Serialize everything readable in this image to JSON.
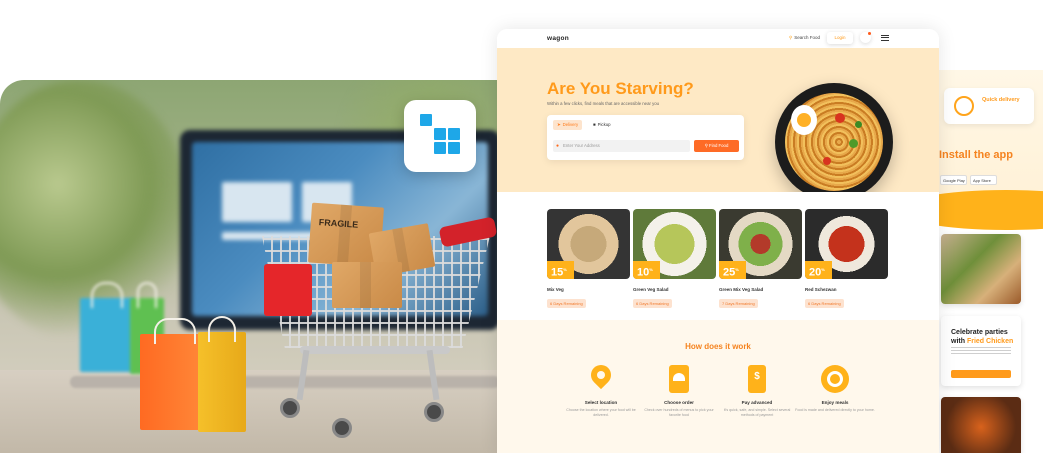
{
  "site": {
    "brand": "wagon",
    "nav": {
      "search": "Search Food",
      "login": "Login"
    },
    "hero": {
      "title": "Are You Starving?",
      "subtitle": "Within a few clicks, find meals that are accessible near you",
      "tabs": [
        {
          "label": "Delivery"
        },
        {
          "label": "Pickup"
        }
      ],
      "address_placeholder": "Enter Your Address",
      "find_button": "Find Food"
    },
    "foods": [
      {
        "discount": "15",
        "name": "Mix Veg",
        "remaining": "6 Days Remaining"
      },
      {
        "discount": "10",
        "name": "Green Veg Salad",
        "remaining": "6 Days Remaining"
      },
      {
        "discount": "25",
        "name": "Green Mix Veg Salad",
        "remaining": "7 Days Remaining"
      },
      {
        "discount": "20",
        "name": "Red Schezwan",
        "remaining": "6 Days Remaining"
      }
    ],
    "discount_suffix": "%",
    "how": {
      "title": "How does it work",
      "steps": [
        {
          "label": "Select location",
          "desc": "Choose the location where your food will be delivered."
        },
        {
          "label": "Choose order",
          "desc": "Check over hundreds of menus to pick your favorite food"
        },
        {
          "label": "Pay advanced",
          "desc": "It's quick, safe, and simple. Select several methods of payment"
        },
        {
          "label": "Enjoy meals",
          "desc": "Food is made and delivered directly to your home."
        }
      ]
    }
  },
  "side": {
    "quick_delivery": "Quick delivery",
    "install": "Install the app",
    "stores": [
      "Google Play",
      "App Store"
    ],
    "celebrate": {
      "line1": "Celebrate parties",
      "line2_prefix": "with ",
      "highlight": "Fried Chicken"
    }
  },
  "photo": {
    "box_label": "FRAGILE"
  },
  "colors": {
    "accent": "#ff9a1b",
    "hero_bg": "#fee9c5",
    "find_button": "#fe6b26",
    "logo_blue": "#1ea7e8"
  }
}
